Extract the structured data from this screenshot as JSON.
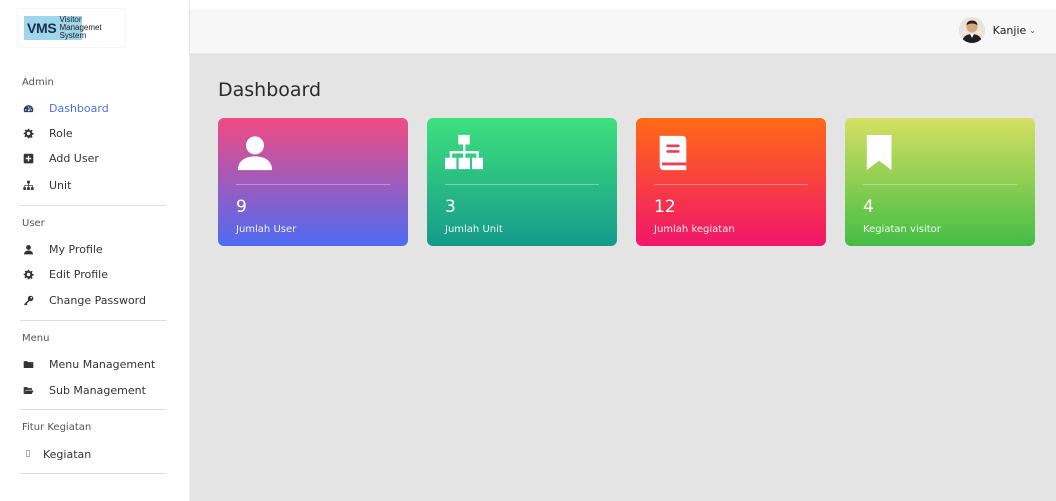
{
  "brand": {
    "mark": "VMS",
    "line1": "Visitor",
    "line2": "Managemet",
    "line3": "System"
  },
  "sidebar": {
    "sections": [
      {
        "heading": "Admin",
        "items": [
          {
            "label": "Dashboard",
            "icon": "tachometer-icon",
            "active": true
          },
          {
            "label": "Role",
            "icon": "gear-icon"
          },
          {
            "label": "Add User",
            "icon": "plus-square-icon"
          },
          {
            "label": "Unit",
            "icon": "sitemap-icon"
          }
        ]
      },
      {
        "heading": "User",
        "items": [
          {
            "label": "My Profile",
            "icon": "user-icon"
          },
          {
            "label": "Edit Profile",
            "icon": "gear-icon"
          },
          {
            "label": "Change Password",
            "icon": "key-icon"
          }
        ]
      },
      {
        "heading": "Menu",
        "items": [
          {
            "label": "Menu Management",
            "icon": "folder-icon"
          },
          {
            "label": "Sub Management",
            "icon": "folder-open-icon"
          }
        ]
      },
      {
        "heading": "Fitur Kegiatan",
        "items": [
          {
            "label": "Kegiatan",
            "icon": "missing-glyph-icon",
            "glyph": "▯"
          }
        ]
      }
    ]
  },
  "topbar": {
    "user_name": "Kanjie",
    "caret": "⌄"
  },
  "main": {
    "title": "Dashboard",
    "cards": [
      {
        "value": "9",
        "label": "Jumlah User",
        "icon": "user-icon"
      },
      {
        "value": "3",
        "label": "Jumlah Unit",
        "icon": "sitemap-icon"
      },
      {
        "value": "12",
        "label": "Jumlah kegiatan",
        "icon": "book-icon"
      },
      {
        "value": "4",
        "label": "Kegiatan visitor",
        "icon": "bookmark-icon"
      }
    ]
  },
  "colors": {
    "accent": "#4e73df",
    "content_bg": "#e4e4e4"
  }
}
